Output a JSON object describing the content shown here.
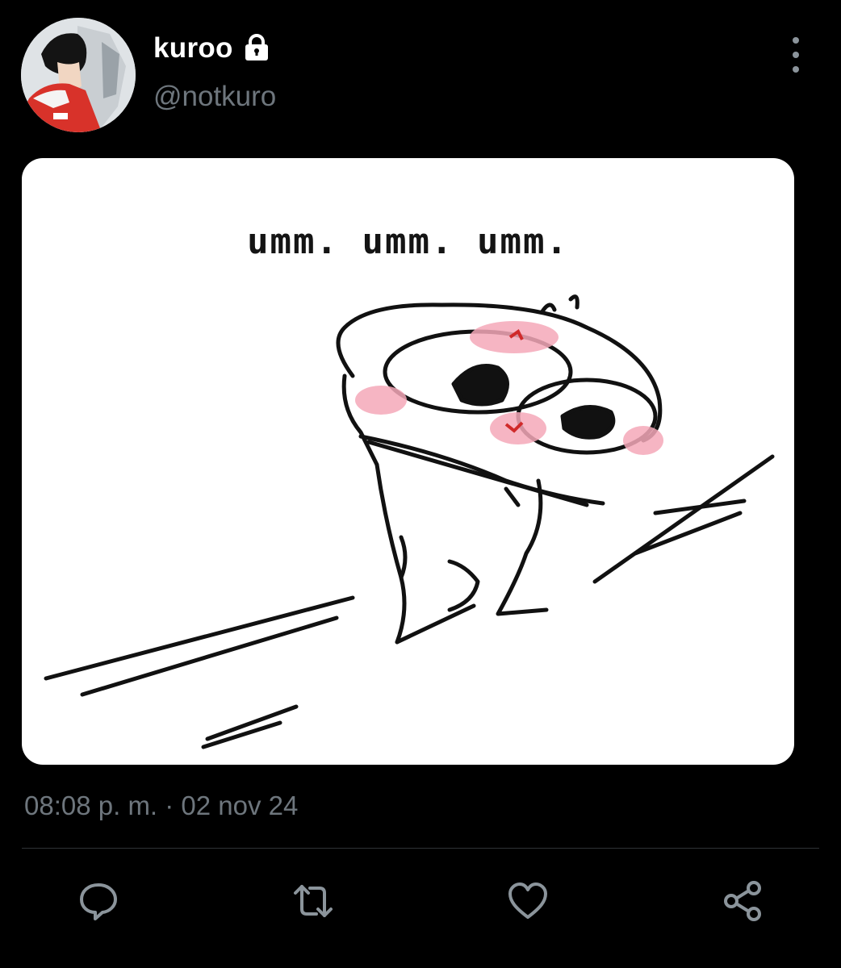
{
  "user": {
    "display_name": "kuroo",
    "handle": "@notkuro",
    "protected_icon": "lock-icon",
    "avatar_icon": "anime-avatar"
  },
  "tweet": {
    "media": {
      "caption_text": "umm. umm. umm.",
      "description_icon": "blushing-meme-image"
    },
    "timestamp": "08:08 p. m. · 02 nov 24"
  },
  "actions": [
    {
      "icon": "reply-icon"
    },
    {
      "icon": "retweet-icon"
    },
    {
      "icon": "like-icon"
    },
    {
      "icon": "share-icon"
    }
  ],
  "colors": {
    "background": "#000000",
    "text_primary": "#ffffff",
    "text_secondary": "#6e767d",
    "icon": "#8b949b",
    "divider": "#2f3336",
    "blush": "#f5a8b8"
  }
}
